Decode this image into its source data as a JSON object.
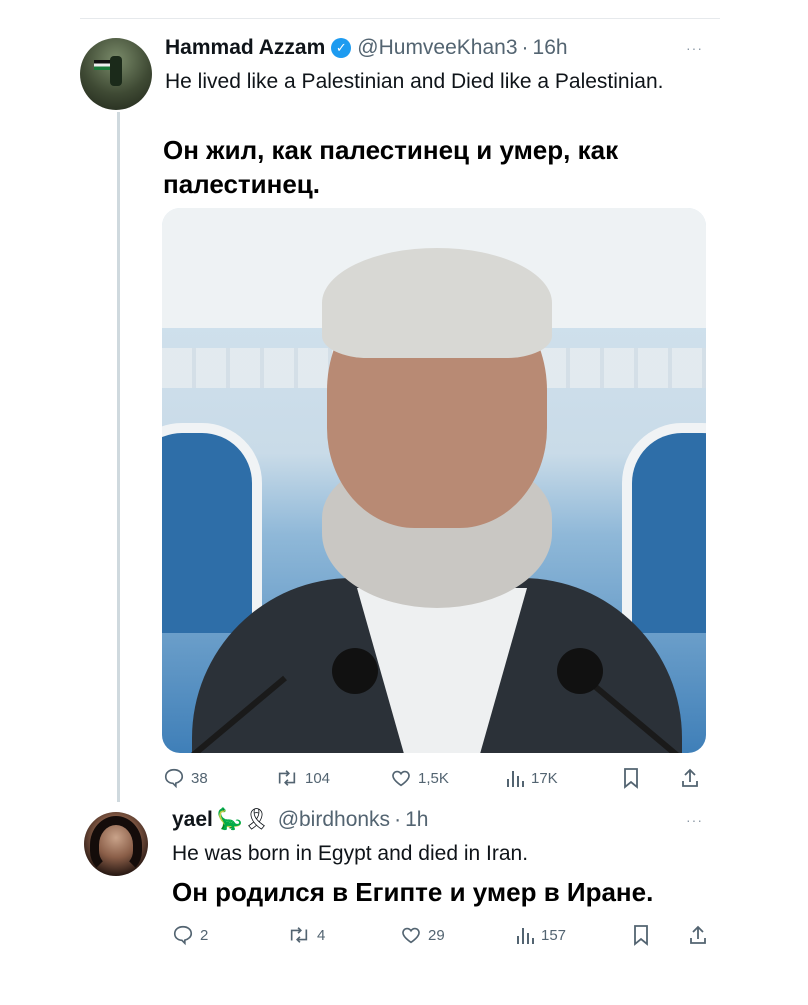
{
  "tweet1": {
    "author_name": "Hammad Azzam",
    "verified_mark": "✓",
    "handle": "@HumveeKhan3",
    "separator": "·",
    "time": "16h",
    "more": "···",
    "text": "He lived like a Palestinian and Died like a Palestinian.",
    "translation": "Он жил, как палестинец и умер, как палестинец.",
    "stats": {
      "replies": "38",
      "retweets": "104",
      "likes": "1,5K",
      "views": "17K"
    },
    "icons": [
      "reply-icon",
      "retweet-icon",
      "like-icon",
      "views-icon",
      "bookmark-icon",
      "share-icon"
    ]
  },
  "tweet2": {
    "author_name": "yael",
    "name_emojis": "🦕🎗",
    "handle": "@birdhonks",
    "separator": "·",
    "time": "1h",
    "more": "···",
    "text": "He was born in Egypt and died in Iran.",
    "translation": "Он родился в Египте и умер в Иране.",
    "stats": {
      "replies": "2",
      "retweets": "4",
      "likes": "29",
      "views": "157"
    }
  },
  "colors": {
    "verified": "#1d9bf0",
    "secondary_text": "#536471",
    "thread_line": "#cfd9de"
  }
}
